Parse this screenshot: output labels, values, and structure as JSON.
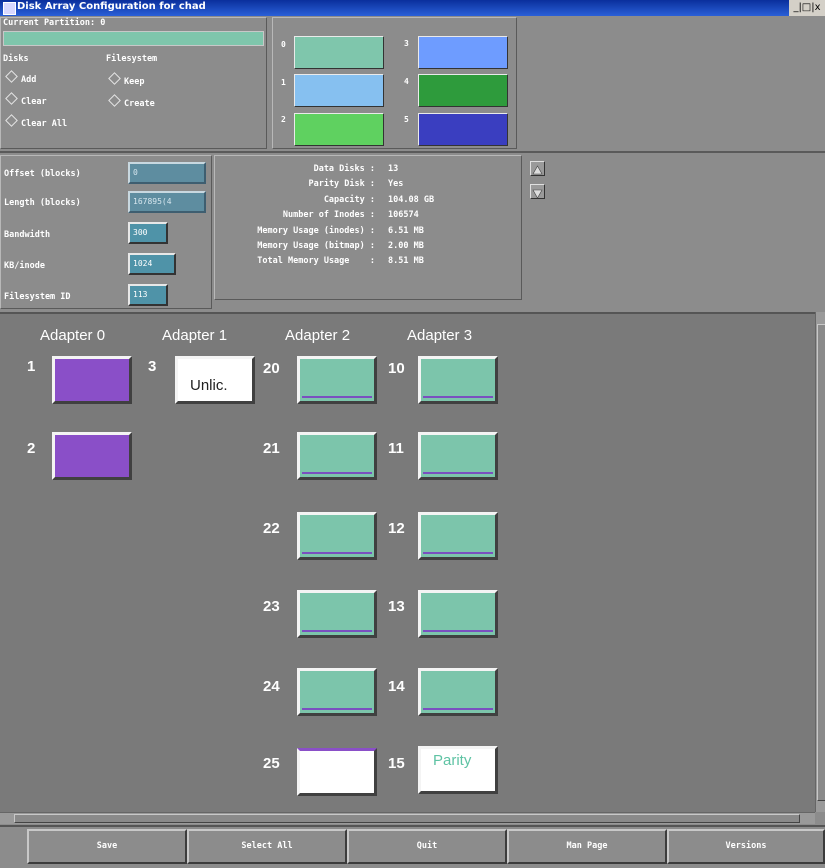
{
  "window": {
    "title": "Disk Array Configuration for chad",
    "controls": "_|□|x"
  },
  "partition": {
    "label": "Current Partition:",
    "value": "0"
  },
  "disks": {
    "heading": "Disks",
    "options": [
      "Add",
      "Clear",
      "Clear All"
    ]
  },
  "filesystem": {
    "heading": "Filesystem",
    "options": [
      "Keep",
      "Create"
    ]
  },
  "partition_swatches": [
    {
      "number": "0",
      "color": "#7fc6ac"
    },
    {
      "number": "1",
      "color": "#86c0f0"
    },
    {
      "number": "2",
      "color": "#5fd160"
    },
    {
      "number": "3",
      "color": "#6e9cff"
    },
    {
      "number": "4",
      "color": "#2e9b3c"
    },
    {
      "number": "5",
      "color": "#3a3ec0"
    }
  ],
  "fields": [
    {
      "label": "Offset (blocks)",
      "value": "0"
    },
    {
      "label": "Length (blocks)",
      "value": "167895(4"
    },
    {
      "label": "Bandwidth",
      "value": "300"
    },
    {
      "label": "KB/inode",
      "value": "1024"
    },
    {
      "label": "Filesystem ID",
      "value": "113"
    }
  ],
  "stats": [
    {
      "label": "Data Disks :",
      "value": "13"
    },
    {
      "label": "Parity Disk :",
      "value": "Yes"
    },
    {
      "label": "Capacity :",
      "value": "104.08 GB"
    },
    {
      "label": "Number of Inodes :",
      "value": "106574"
    },
    {
      "label": "Memory Usage (inodes) :",
      "value": "6.51 MB"
    },
    {
      "label": "Memory Usage (bitmap) :",
      "value": "2.00 MB"
    },
    {
      "label": "Total Memory Usage    :",
      "value": "8.51 MB"
    }
  ],
  "adapters": [
    "Adapter 0",
    "Adapter 1",
    "Adapter 2",
    "Adapter 3"
  ],
  "disk_slots": [
    {
      "number": "1",
      "state": "purple",
      "text": ""
    },
    {
      "number": "2",
      "state": "purple",
      "text": ""
    },
    {
      "number": "3",
      "state": "white",
      "text": "Unlic."
    },
    {
      "number": "20",
      "state": "teal",
      "text": ""
    },
    {
      "number": "21",
      "state": "teal",
      "text": ""
    },
    {
      "number": "22",
      "state": "teal",
      "text": ""
    },
    {
      "number": "23",
      "state": "teal",
      "text": ""
    },
    {
      "number": "24",
      "state": "teal",
      "text": ""
    },
    {
      "number": "25",
      "state": "white",
      "text": ""
    },
    {
      "number": "10",
      "state": "teal",
      "text": ""
    },
    {
      "number": "11",
      "state": "teal",
      "text": ""
    },
    {
      "number": "12",
      "state": "teal",
      "text": ""
    },
    {
      "number": "13",
      "state": "teal",
      "text": ""
    },
    {
      "number": "14",
      "state": "teal",
      "text": ""
    },
    {
      "number": "15",
      "state": "white",
      "text": "Parity"
    }
  ],
  "buttons": [
    "Save",
    "Select All",
    "Quit",
    "Man Page",
    "Versions"
  ]
}
